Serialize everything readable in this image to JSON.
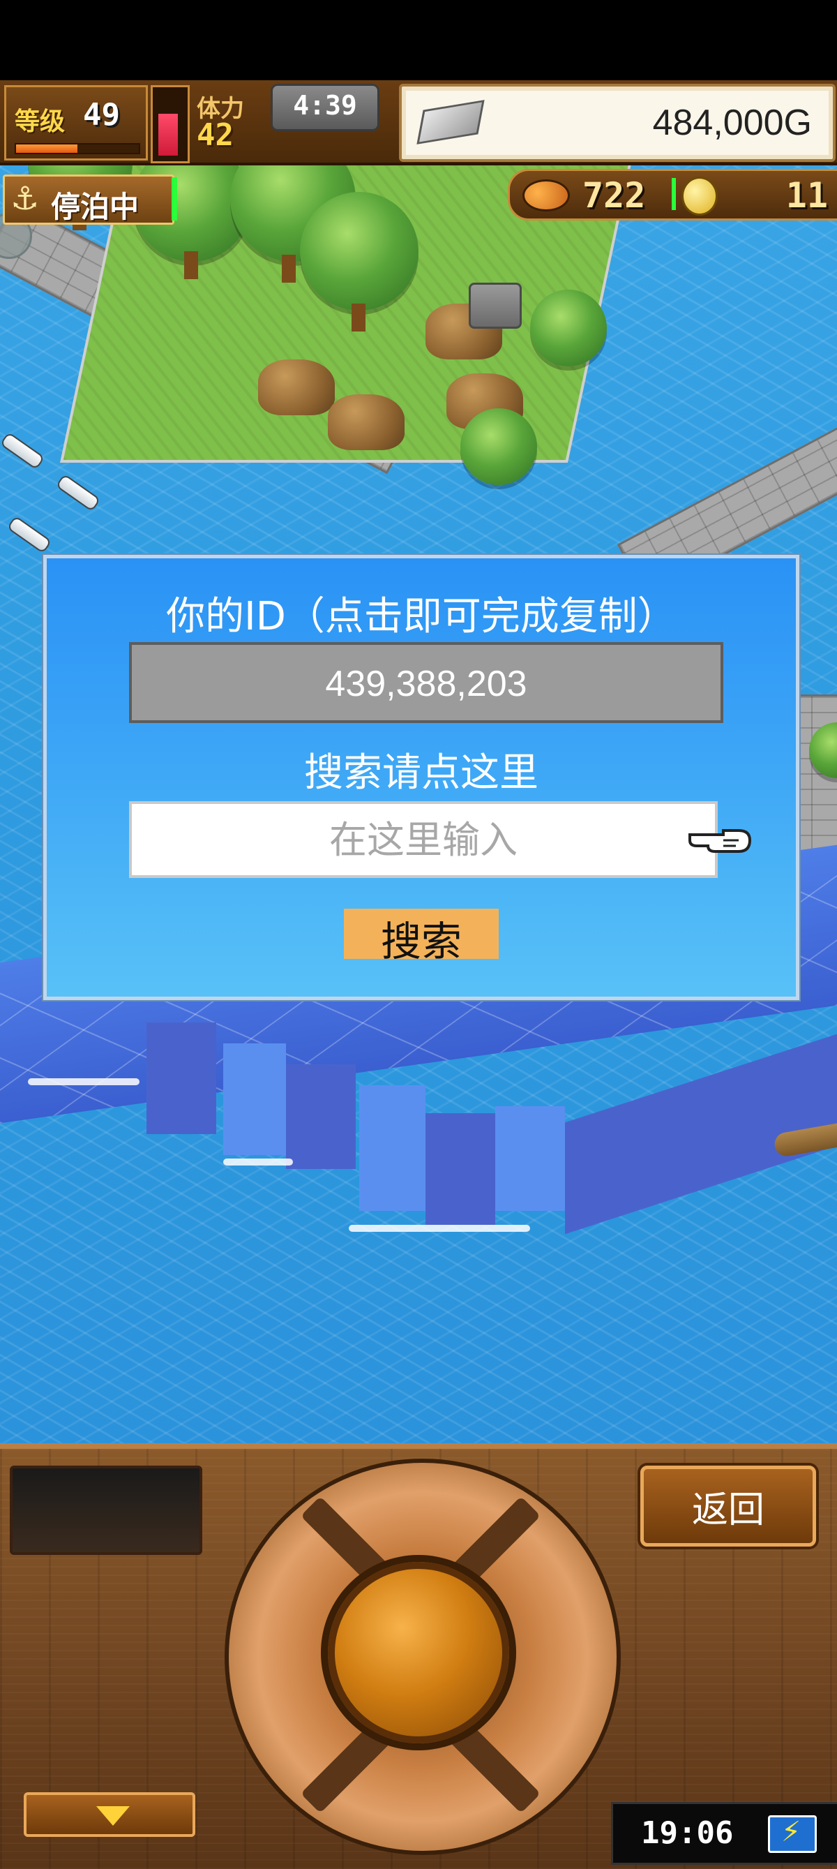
{
  "hud": {
    "level_label": "等级",
    "level_value": "49",
    "exp_fraction": 0.5,
    "hp_fraction": 0.72,
    "stamina_label": "体力",
    "stamina_value": "42",
    "timer": "4:39",
    "gold": "484,000G",
    "moor_status": "停泊中",
    "resource_a": "722",
    "resource_b": "11"
  },
  "dialog": {
    "title": "你的ID（点击即可完成复制）",
    "id_value": "439,388,203",
    "search_label": "搜索请点这里",
    "search_placeholder": "在这里输入",
    "search_button": "搜索"
  },
  "controls": {
    "back_button": "返回",
    "clock": "19:06"
  },
  "icons": {
    "silver": "silver-bar-icon",
    "anchor": "anchor-icon",
    "fish": "fish-icon",
    "coin": "coin-icon",
    "hand": "pointing-hand-icon",
    "battery": "battery-charging-icon",
    "down": "down-arrow-icon"
  },
  "colors": {
    "dialog_top": "#2a92f5",
    "dialog_bottom": "#58c1f7",
    "id_field": "#9b9b9b",
    "search_button": "#f3b25a",
    "hp": "#d01a38",
    "exp": "#e35a10",
    "gold_text": "#222222"
  }
}
